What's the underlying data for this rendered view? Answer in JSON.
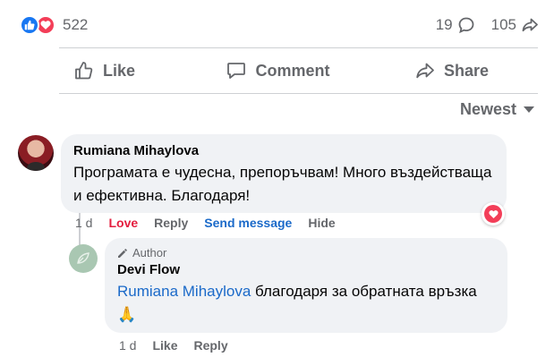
{
  "reactions": {
    "count": "522",
    "icons": [
      "like-icon",
      "love-icon"
    ]
  },
  "stats": {
    "comments": "19",
    "shares": "105"
  },
  "actions": {
    "like": "Like",
    "comment": "Comment",
    "share": "Share"
  },
  "sort": {
    "label": "Newest"
  },
  "comments": [
    {
      "author": "Rumiana Mihaylova",
      "text": "Програмата е чудесна, препоръчвам! Много въздействаща и ефективна. Благодаря!",
      "time": "1 d",
      "actions": {
        "love": "Love",
        "reply": "Reply",
        "send": "Send message",
        "hide": "Hide"
      },
      "reaction": "love"
    }
  ],
  "reply": {
    "badge": "Author",
    "author": "Devi Flow",
    "mention": "Rumiana Mihaylova",
    "text": " благодаря за обратната връзка 🙏",
    "time": "1 d",
    "actions": {
      "like": "Like",
      "reply": "Reply"
    }
  },
  "colors": {
    "like": "#1877f2",
    "love": "#f33e58",
    "link": "#1b6ac9",
    "muted": "#65676b",
    "bubble": "#f0f2f5"
  }
}
